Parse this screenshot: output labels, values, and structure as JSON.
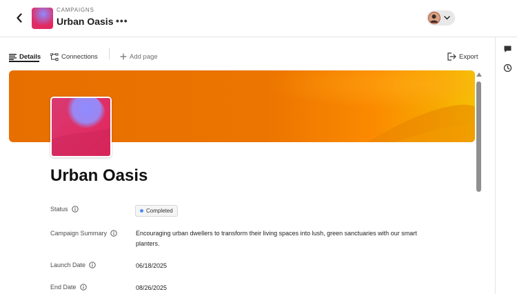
{
  "header": {
    "breadcrumb": "CAMPAIGNS",
    "title": "Urban Oasis",
    "more_label": "•••"
  },
  "tabs": [
    {
      "label": "Details",
      "icon": "details-lines-icon",
      "active": true
    },
    {
      "label": "Connections",
      "icon": "connections-icon",
      "active": false
    },
    {
      "label": "Add page",
      "icon": "plus-icon",
      "active": false
    }
  ],
  "export_label": "Export",
  "page_heading": "Urban Oasis",
  "fields": {
    "status": {
      "label": "Status",
      "value": "Completed",
      "dot_color": "#4d8ef7"
    },
    "summary": {
      "label": "Campaign Summary",
      "value": "Encouraging urban dwellers to transform their living spaces into lush, green sanctuaries with our smart planters."
    },
    "launch_date": {
      "label": "Launch Date",
      "value": "06/18/2025"
    },
    "end_date": {
      "label": "End Date",
      "value": "08/26/2025"
    }
  },
  "rail": [
    {
      "icon": "comment-icon"
    },
    {
      "icon": "history-clock-icon"
    }
  ],
  "colors": {
    "banner_start": "#e76f00",
    "banner_end": "#f4c200",
    "cover_pink": "#e02c6e",
    "cover_violet": "#8f8bff"
  }
}
